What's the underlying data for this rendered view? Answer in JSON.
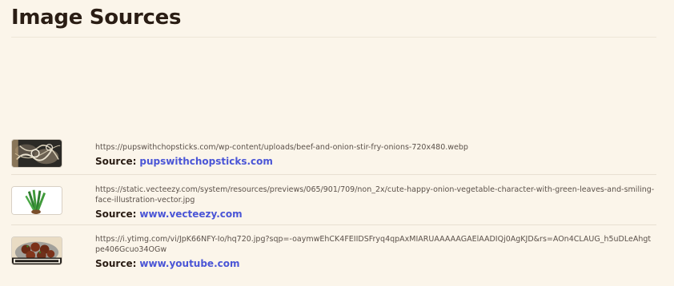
{
  "heading": "Image Sources",
  "source_label": "Source:",
  "sources": [
    {
      "url": "https://pupswithchopsticks.com/wp-content/uploads/beef-and-onion-stir-fry-onions-720x480.webp",
      "source_name": "pupswithchopsticks.com",
      "thumbnail": "onion-stir-fry-thumbnail"
    },
    {
      "url": "https://static.vecteezy.com/system/resources/previews/065/901/709/non_2x/cute-happy-onion-vegetable-character-with-green-leaves-and-smiling-face-illustration-vector.jpg",
      "source_name": "www.vecteezy.com",
      "thumbnail": "onion-character-thumbnail"
    },
    {
      "url": "https://i.ytimg.com/vi/JpK66NFY-Io/hq720.jpg?sqp=-oaymwEhCK4FEIIDSFryq4qpAxMIARUAAAAAGAElAADIQj0AgKJD&rs=AOn4CLAUG_h5uDLeAhgtpe406Gcuo34OGw",
      "source_name": "www.youtube.com",
      "thumbnail": "meatballs-video-thumbnail"
    }
  ]
}
